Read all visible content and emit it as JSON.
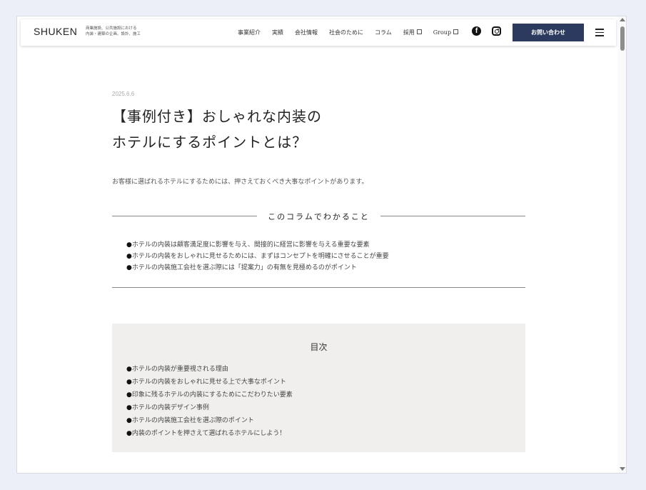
{
  "header": {
    "logo": "SHUKEN",
    "tagline_line1": "商業施設、公共施設における",
    "tagline_line2": "内装・建築の企画、設計、施工",
    "nav": [
      "事業紹介",
      "実績",
      "会社情報",
      "社会のために",
      "コラム",
      "採用",
      "Group"
    ],
    "contact_button": "お問い合わせ"
  },
  "article": {
    "date": "2025.6.6",
    "title_line1": "【事例付き】おしゃれな内装の",
    "title_line2": "ホテルにするポイントとは？",
    "intro": "お客様に選ばれるホテルにするためには、押さえておくべき大事なポイントがあります。",
    "learn_heading": "このコラムでわかること",
    "learn_items": [
      "ホテルの内装は顧客満足度に影響を与え、間接的に経営に影響を与える重要な要素",
      "ホテルの内装をおしゃれに見せるためには、まずはコンセプトを明確にさせることが重要",
      "ホテルの内装施工会社を選ぶ際には「提案力」の有無を見極めるのがポイント"
    ],
    "toc_title": "目次",
    "toc_items": [
      "ホテルの内装が重要視される理由",
      "ホテルの内装をおしゃれに見せる上で大事なポイント",
      "印象に残るホテルの内装にするためにこだわりたい要素",
      "ホテルの内装デザイン事例",
      "ホテルの内装施工会社を選ぶ際のポイント",
      "内装のポイントを押さえて選ばれるホテルにしよう！"
    ]
  },
  "colors": {
    "accent": "#2b3a5e",
    "toc_bg": "#f0efed"
  }
}
